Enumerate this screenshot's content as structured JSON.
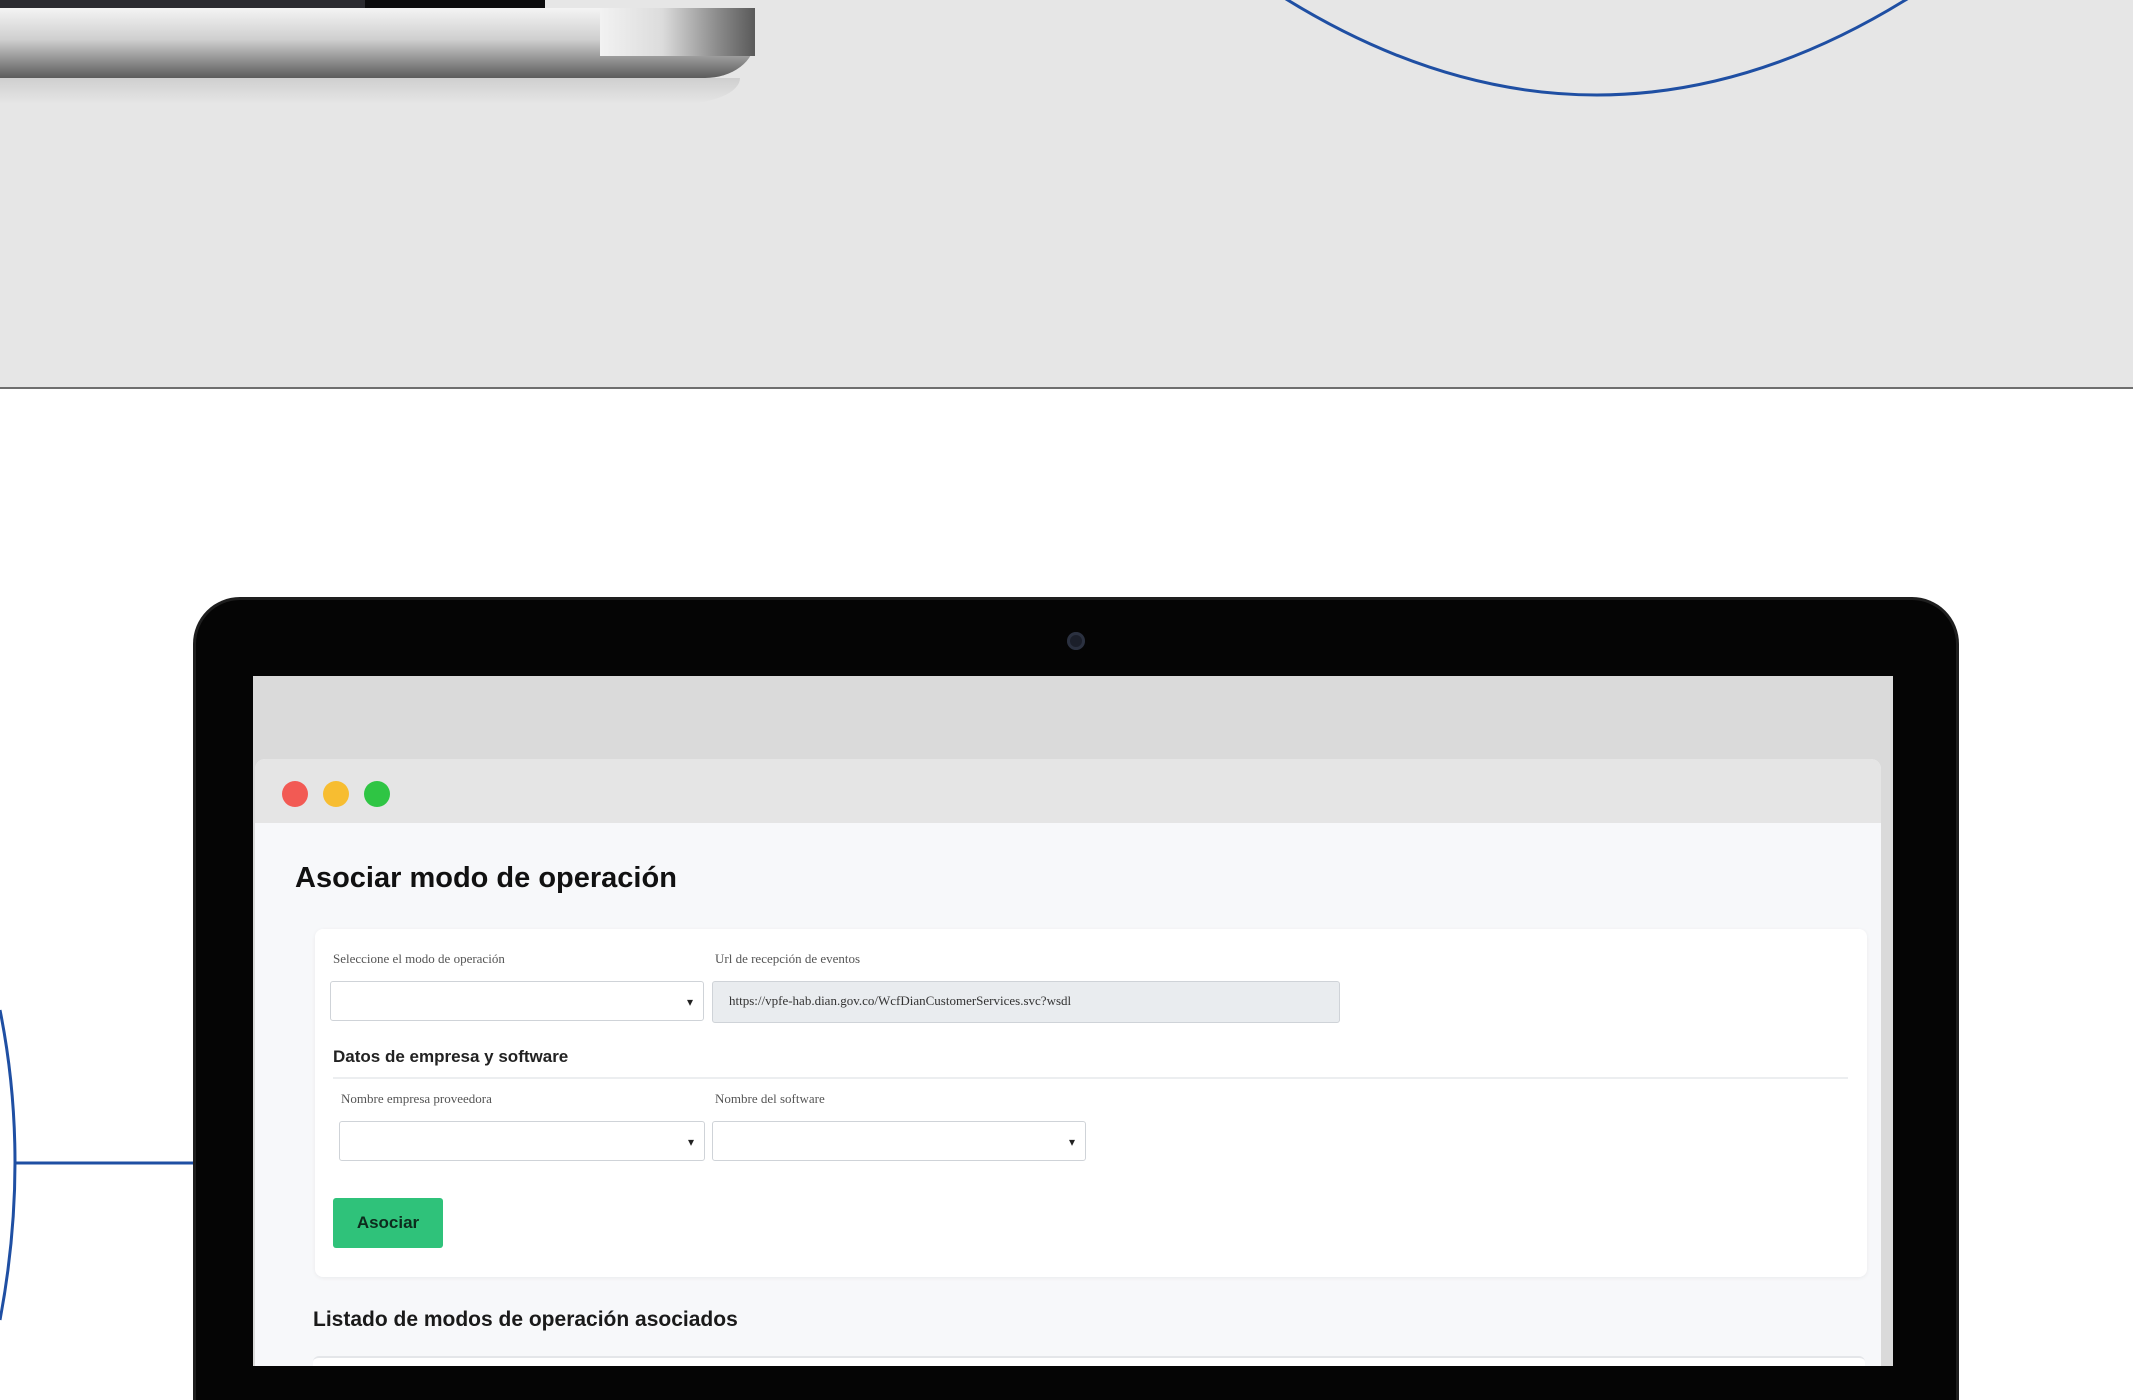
{
  "window": {
    "title": "Asociar modo de operación",
    "controls": {
      "close_color": "#f25a54",
      "minimize_color": "#f7bd31",
      "maximize_color": "#2fc544"
    }
  },
  "form": {
    "mode_label": "Seleccione el modo de operación",
    "mode_value": "",
    "url_label": "Url de recepción de eventos",
    "url_value": "https://vpfe-hab.dian.gov.co/WcfDianCustomerServices.svc?wsdl",
    "company_section_title": "Datos de empresa y software",
    "provider_label": "Nombre empresa proveedora",
    "provider_value": "",
    "software_label": "Nombre del software",
    "software_value": "",
    "submit_label": "Asociar"
  },
  "list": {
    "title": "Listado de modos de operación asociados"
  },
  "colors": {
    "accent_blue": "#1f4fa3",
    "button_green": "#2fc27a",
    "background_grey": "#e6e6e6"
  },
  "icons": {
    "dropdown": "chevron-down-icon",
    "camera": "camera-icon"
  }
}
